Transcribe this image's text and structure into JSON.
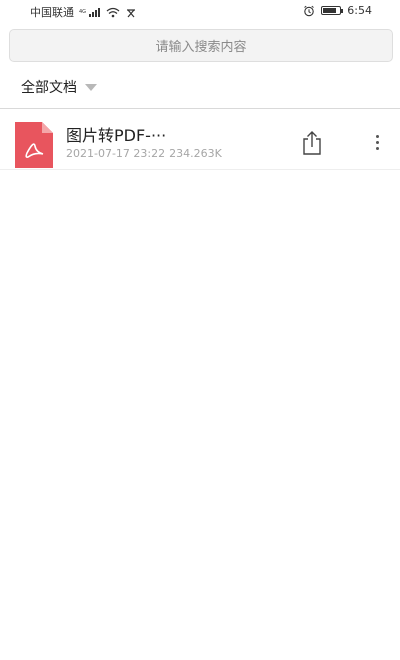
{
  "status_bar": {
    "carrier": "中国联通",
    "network_label": "4G",
    "time": "6:54",
    "battery_level": 0.8
  },
  "search": {
    "placeholder": "请输入搜索内容"
  },
  "filter": {
    "label": "全部文档"
  },
  "files": [
    {
      "name": "图片转PDF-···",
      "datetime": "2021-07-17 23:22",
      "size": "234.263K",
      "type_icon": "pdf-icon"
    }
  ],
  "colors": {
    "pdf_icon": "#e8555e",
    "pdf_fold": "#f4a6a9"
  }
}
